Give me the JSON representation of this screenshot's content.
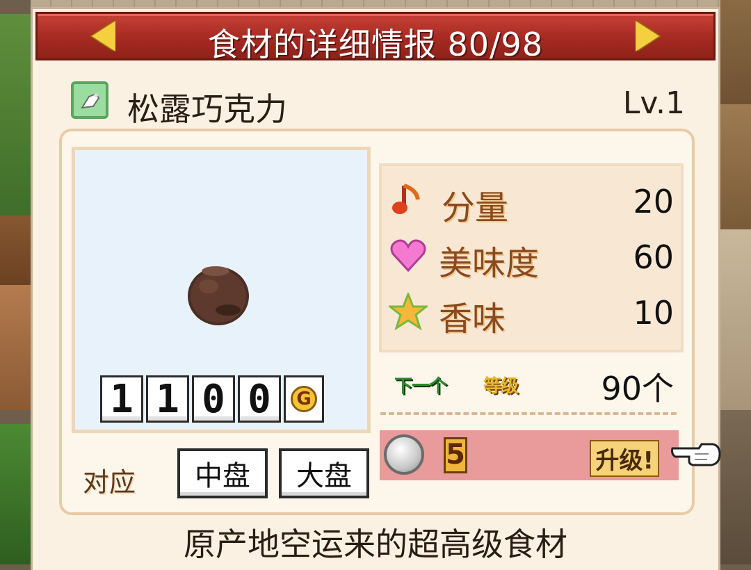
{
  "header": {
    "title": "食材的详细情报 80/98",
    "prev_icon": "arrow-left-icon",
    "next_icon": "arrow-right-icon"
  },
  "ingredient": {
    "name": "松露巧克力",
    "level": "Lv.1",
    "icon": "candy-icon",
    "price_digits": [
      "1",
      "1",
      "0",
      "0"
    ],
    "currency": "G",
    "description": "原产地空运来的超高级食材"
  },
  "dishes": {
    "label": "对应",
    "options": [
      "中盘",
      "大盘"
    ]
  },
  "stats": [
    {
      "label": "分量",
      "value": "20",
      "icon": "music-note-icon"
    },
    {
      "label": "美味度",
      "value": "60",
      "icon": "heart-icon"
    },
    {
      "label": "香味",
      "value": "10",
      "icon": "star-icon"
    }
  ],
  "next_level": {
    "badge_next": "下一个",
    "badge_level": "等级",
    "value": "90个"
  },
  "upgrade": {
    "coin_icon": "silver-coin-icon",
    "cost": "5",
    "label": "升级!"
  },
  "colors": {
    "title_red": "#a52a22",
    "panel_bg": "#fbf1e2",
    "upgrade_pink": "#e99a9a",
    "accent_gold": "#f6cf3f"
  }
}
